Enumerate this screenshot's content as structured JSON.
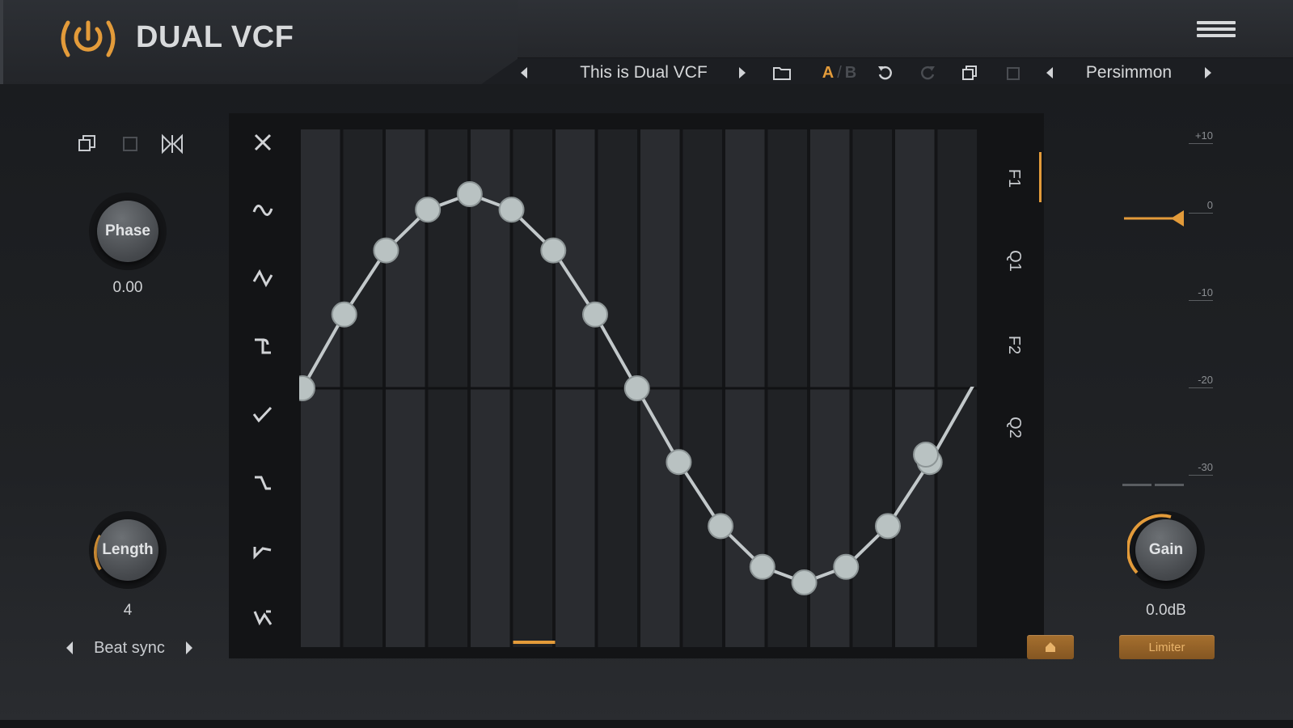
{
  "header": {
    "title": "DUAL VCF",
    "logo_icon": "power-waves-icon",
    "menu_icon": "hamburger-menu-icon"
  },
  "toolbar": {
    "preset_name": "This is Dual VCF",
    "ab_a": "A",
    "ab_sep": "/",
    "ab_b": "B",
    "theme_name": "Persimmon"
  },
  "left": {
    "phase_label": "Phase",
    "phase_value": "0.00",
    "length_label": "Length",
    "length_value": "4",
    "sync_mode": "Beat sync"
  },
  "shapes": [
    "close-x-icon",
    "sine-icon",
    "saw-up-icon",
    "square-icon",
    "ramp-icon",
    "triangle-icon",
    "step-icon",
    "random-icon"
  ],
  "bands": [
    "F1",
    "Q1",
    "F2",
    "Q2"
  ],
  "meter": {
    "ticks": [
      "+10",
      "0",
      "-10",
      "-20",
      "-30"
    ],
    "gain_label": "Gain",
    "gain_value": "0.0dB",
    "limiter_label": "Limiter",
    "reset_icon": "home-icon"
  },
  "lfo": {
    "steps": 16,
    "points": [
      0.0,
      0.38,
      0.71,
      0.92,
      1.0,
      0.92,
      0.71,
      0.38,
      0.0,
      -0.38,
      -0.71,
      -0.92,
      -1.0,
      -0.92,
      -0.71,
      -0.38,
      0.0
    ],
    "accent": "#e39b3a",
    "curve_color": "#c2c8ca"
  }
}
